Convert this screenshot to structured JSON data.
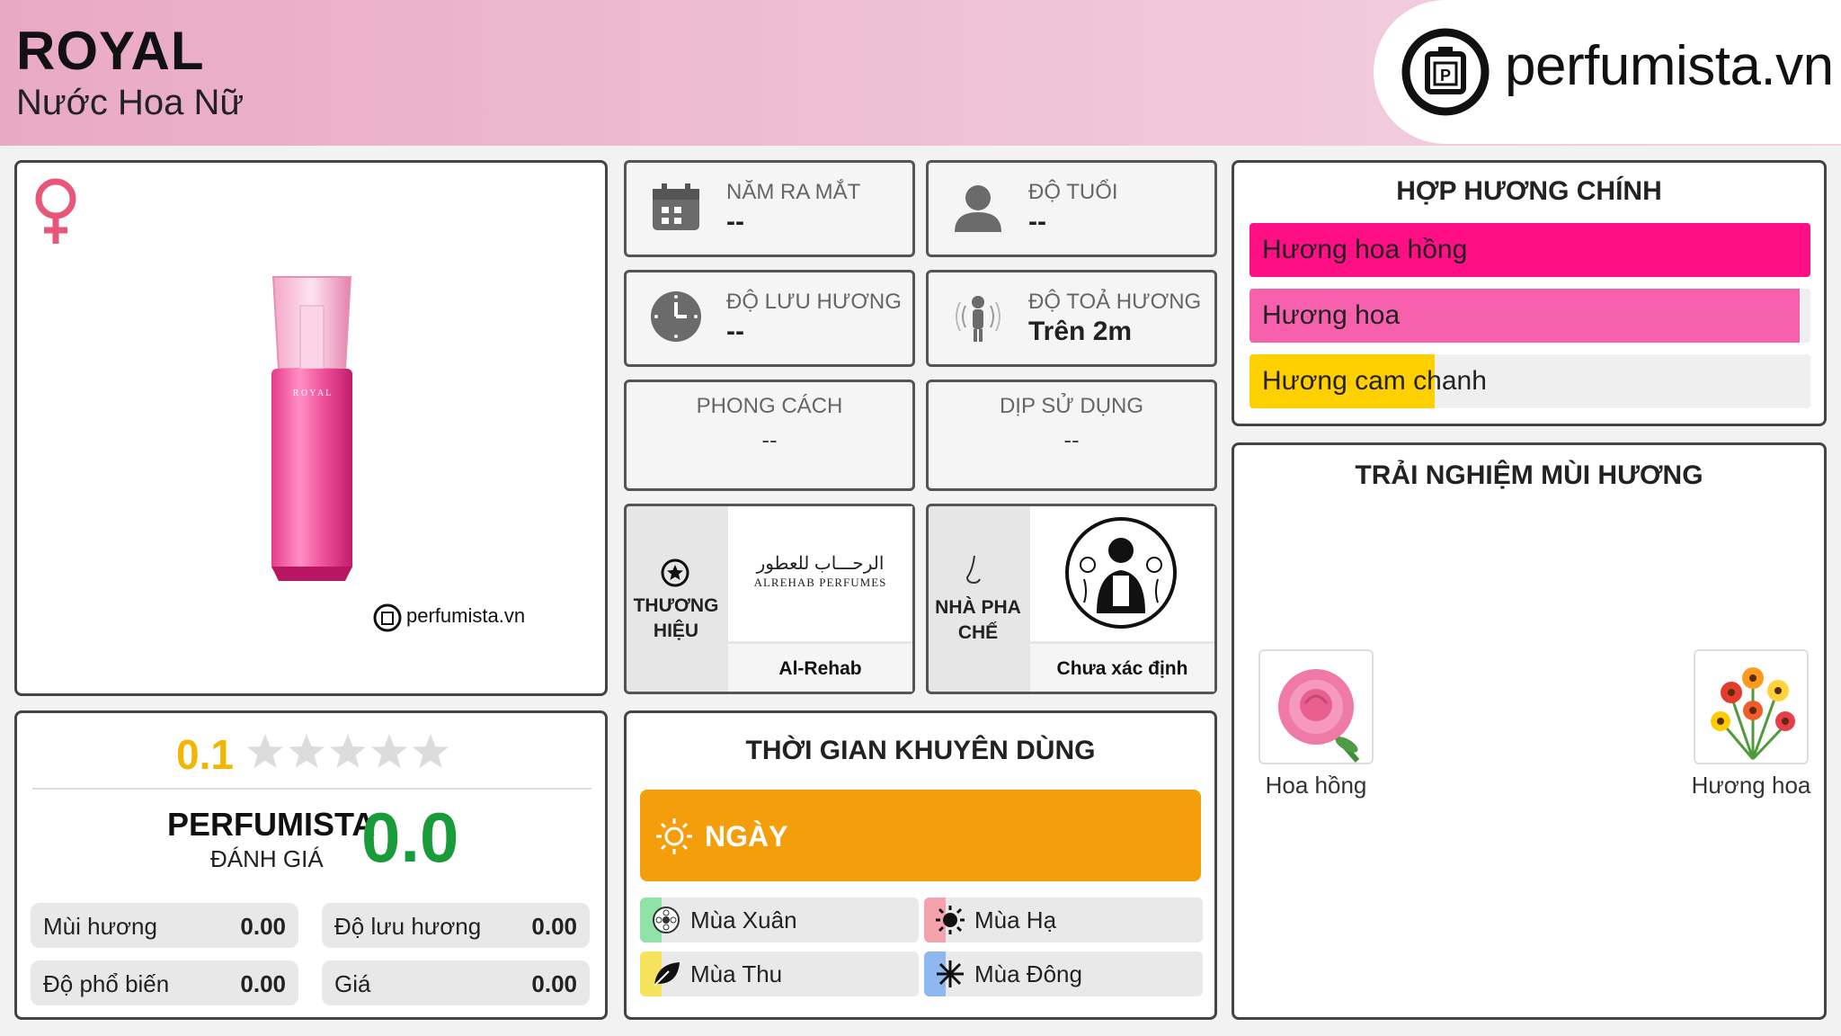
{
  "header": {
    "title": "ROYAL",
    "subtitle": "Nước Hoa Nữ",
    "logo_text": "perfumista.vn"
  },
  "product": {
    "gender_icon": "female-icon",
    "watermark": "perfumista.vn"
  },
  "info_cards": {
    "launch_year": {
      "label": "NĂM RA MẮT",
      "value": "--"
    },
    "age": {
      "label": "ĐỘ TUỔI",
      "value": "--"
    },
    "longevity": {
      "label": "ĐỘ LƯU HƯƠNG",
      "value": "--"
    },
    "sillage": {
      "label": "ĐỘ TOẢ HƯƠNG",
      "value": "Trên 2m"
    },
    "style": {
      "label": "PHONG CÁCH",
      "value": "--"
    },
    "occasion": {
      "label": "DỊP SỬ DỤNG",
      "value": "--"
    }
  },
  "brand": {
    "label": "THƯƠNG HIỆU",
    "logo_arabic": "الرحـــاب للعطور",
    "logo_latin": "ALREHAB PERFUMES",
    "name": "Al-Rehab"
  },
  "perfumer": {
    "label": "NHÀ PHA CHẾ",
    "name": "Chưa xác định"
  },
  "accords": {
    "title": "HỢP HƯƠNG CHÍNH",
    "items": [
      {
        "label": "Hương hoa hồng",
        "level": 100,
        "color": "#ff0f84"
      },
      {
        "label": "Hương hoa",
        "level": 98,
        "color": "#f760ad"
      },
      {
        "label": "Hương cam chanh",
        "level": 33,
        "color": "#ffd000"
      }
    ]
  },
  "experience": {
    "title": "TRẢI NGHIỆM MÙI HƯƠNG",
    "items": [
      {
        "label": "Hoa hồng"
      },
      {
        "label": "Hương hoa"
      }
    ]
  },
  "rating": {
    "score": "0.1",
    "stars_filled": 0,
    "stars_total": 5,
    "brand_label": "PERFUMISTA",
    "eval_label": "ĐÁNH GIÁ",
    "perfumista_score": "0.0",
    "metrics": [
      {
        "label": "Mùi hương",
        "value": "0.00"
      },
      {
        "label": "Độ lưu hương",
        "value": "0.00"
      },
      {
        "label": "Độ phổ biến",
        "value": "0.00"
      },
      {
        "label": "Giá",
        "value": "0.00"
      }
    ]
  },
  "usage_time": {
    "title": "THỜI GIAN KHUYÊN DÙNG",
    "day_label": "NGÀY",
    "day_color": "#f59e0b",
    "seasons": [
      {
        "label": "Mùa Xuân",
        "color": "#8fe3a6"
      },
      {
        "label": "Mùa Hạ",
        "color": "#f4a2ad"
      },
      {
        "label": "Mùa Thu",
        "color": "#f6e25c"
      },
      {
        "label": "Mùa Đông",
        "color": "#8fb8f0"
      }
    ]
  }
}
